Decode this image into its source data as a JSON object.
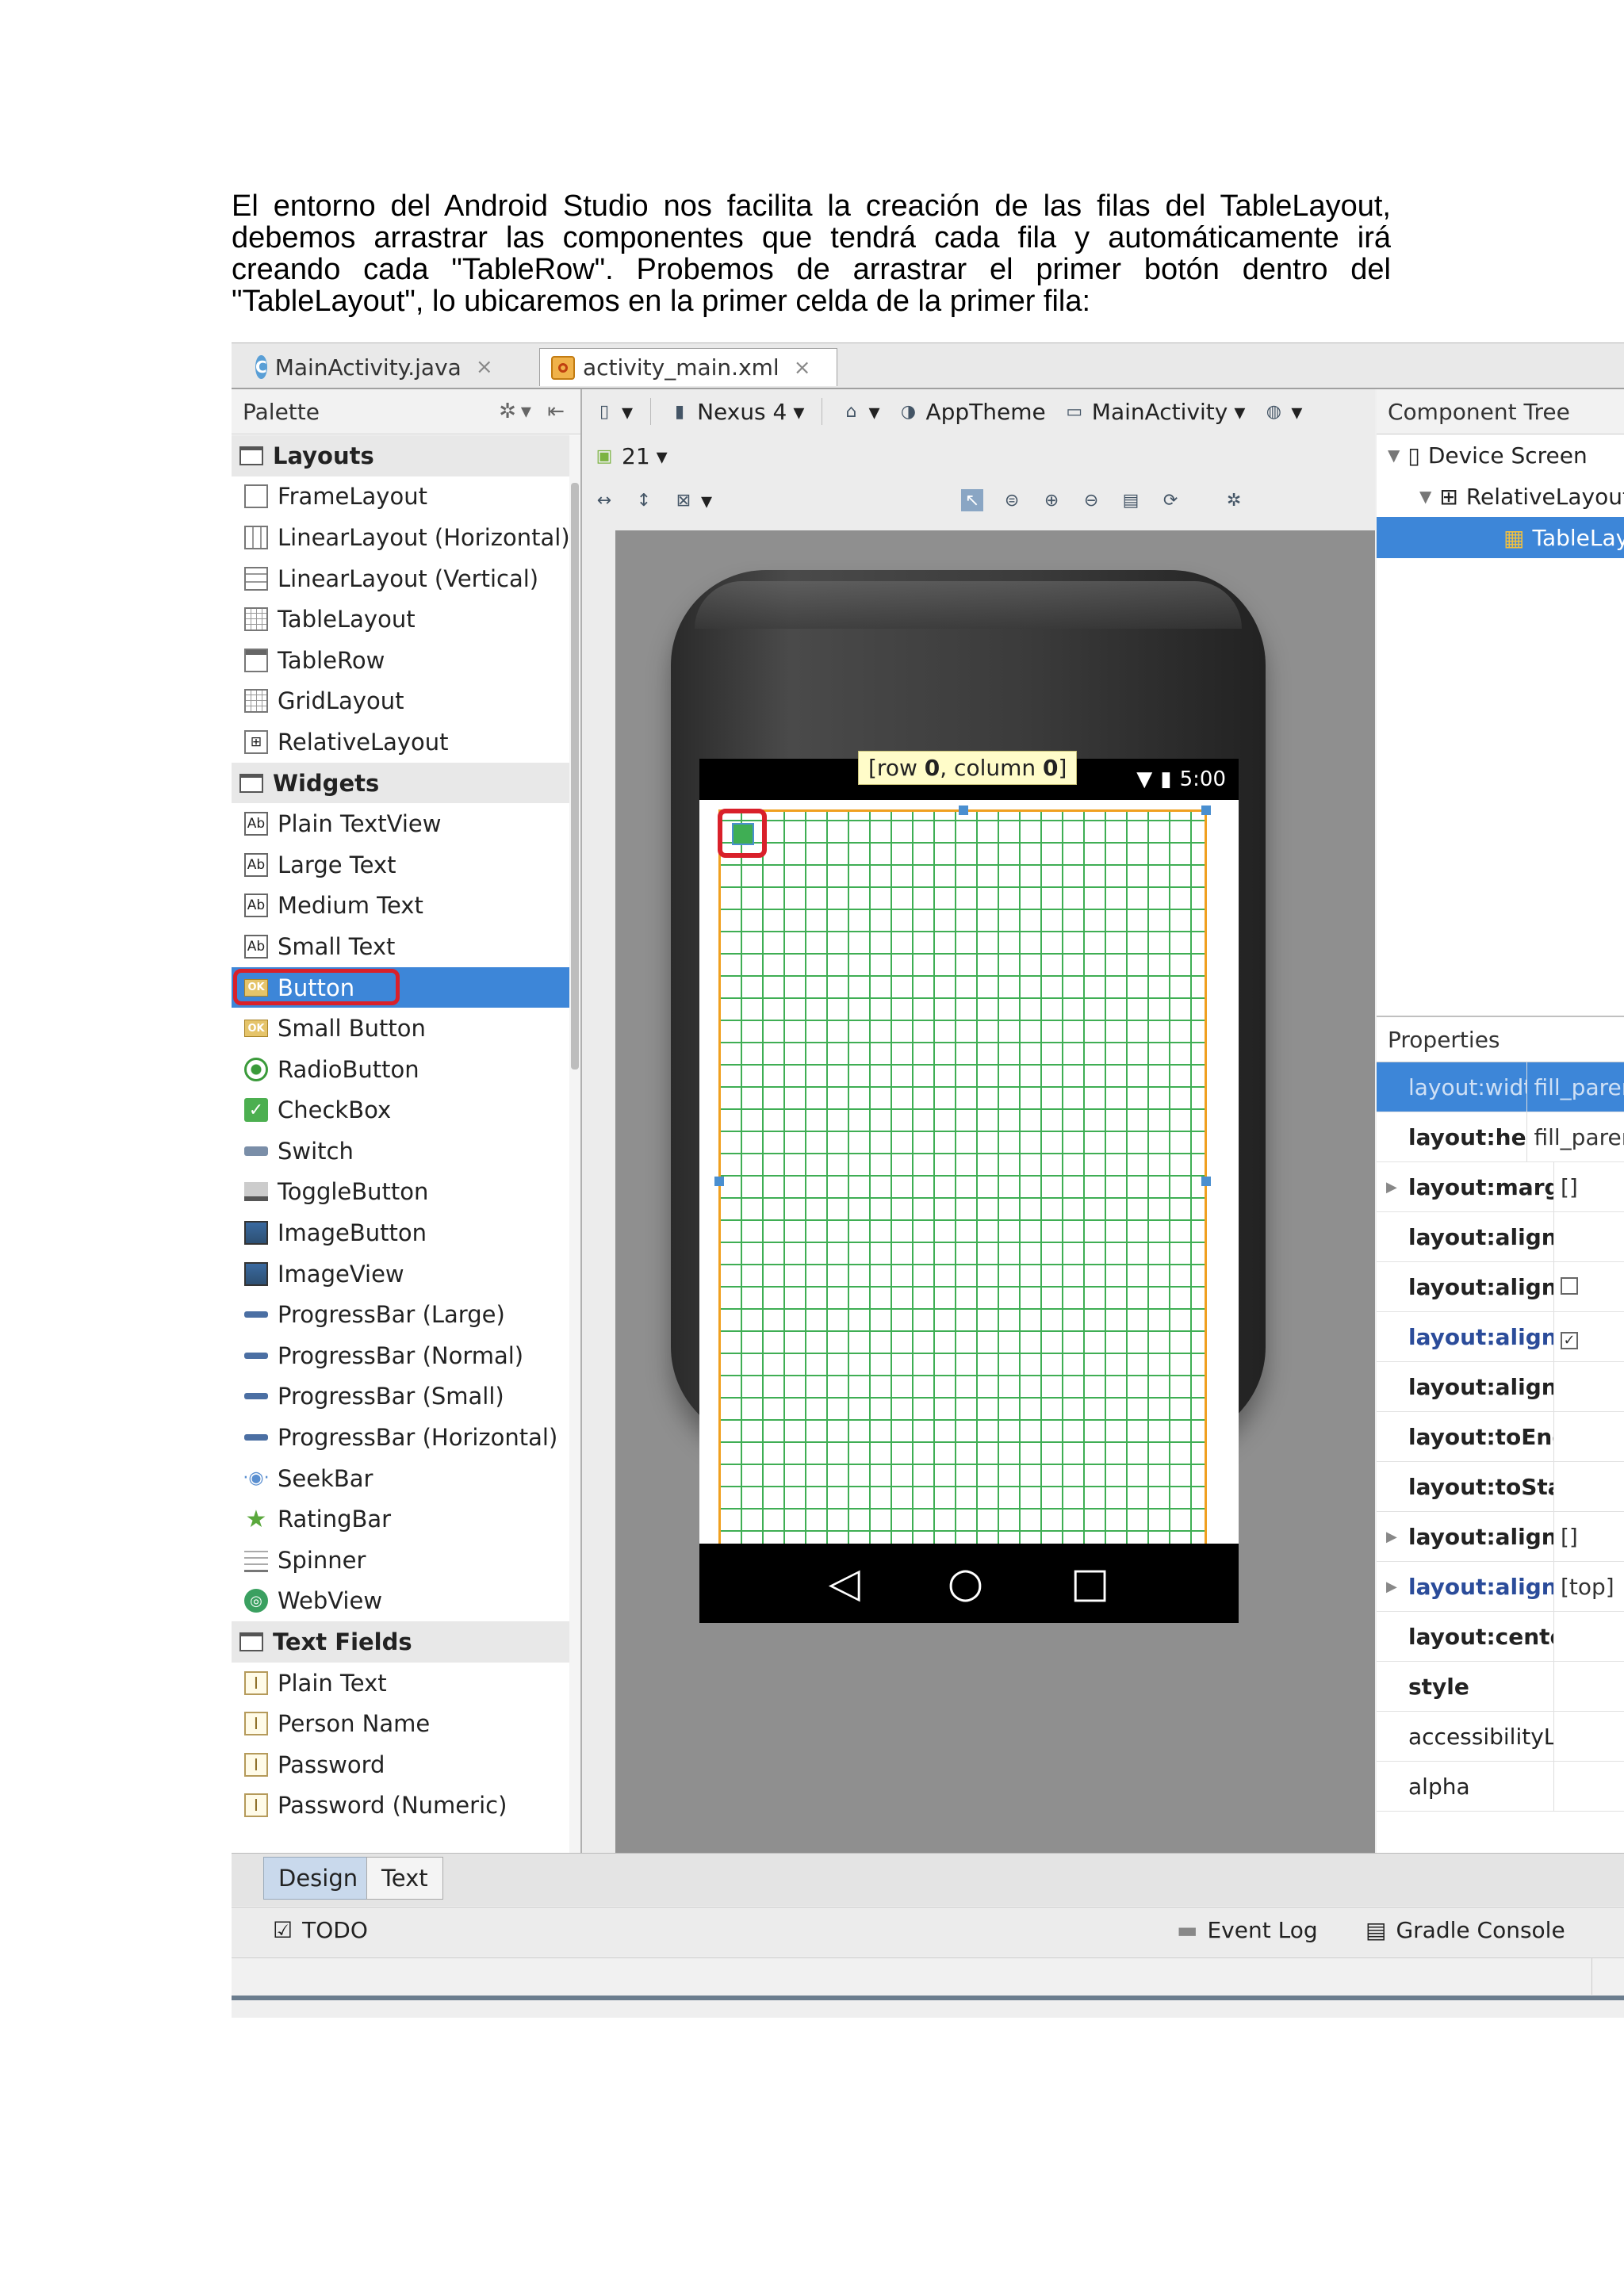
{
  "intro_text": "El entorno del Android Studio nos facilita la creación de las filas del TableLayout, debemos arrastrar las componentes que tendrá cada fila y automáticamente irá creando cada \"TableRow\". Probemos de arrastrar el primer botón dentro del \"TableLayout\", lo ubicaremos en la primer celda de la primer fila:",
  "editor_tabs": [
    {
      "label": "MainActivity.java"
    },
    {
      "label": "activity_main.xml"
    }
  ],
  "palette": {
    "title": "Palette",
    "items": [
      {
        "label": "Layouts",
        "icon": "folder-icon",
        "category": true
      },
      {
        "label": "FrameLayout",
        "icon": "frame-layout-icon"
      },
      {
        "label": "LinearLayout (Horizontal)",
        "icon": "linear-layout-horizontal-icon"
      },
      {
        "label": "LinearLayout (Vertical)",
        "icon": "linear-layout-vertical-icon"
      },
      {
        "label": "TableLayout",
        "icon": "table-layout-icon"
      },
      {
        "label": "TableRow",
        "icon": "table-row-icon"
      },
      {
        "label": "GridLayout",
        "icon": "grid-layout-icon"
      },
      {
        "label": "RelativeLayout",
        "icon": "relative-layout-icon"
      },
      {
        "label": "Widgets",
        "icon": "folder-icon",
        "category": true
      },
      {
        "label": "Plain TextView",
        "icon": "textview-icon"
      },
      {
        "label": "Large Text",
        "icon": "textview-icon"
      },
      {
        "label": "Medium Text",
        "icon": "textview-icon"
      },
      {
        "label": "Small Text",
        "icon": "textview-icon"
      },
      {
        "label": "Button",
        "icon": "button-icon",
        "selected": true
      },
      {
        "label": "Small Button",
        "icon": "button-icon"
      },
      {
        "label": "RadioButton",
        "icon": "radio-icon"
      },
      {
        "label": "CheckBox",
        "icon": "checkbox-icon"
      },
      {
        "label": "Switch",
        "icon": "switch-icon"
      },
      {
        "label": "ToggleButton",
        "icon": "toggle-icon"
      },
      {
        "label": "ImageButton",
        "icon": "image-button-icon"
      },
      {
        "label": "ImageView",
        "icon": "image-view-icon"
      },
      {
        "label": "ProgressBar (Large)",
        "icon": "progressbar-icon"
      },
      {
        "label": "ProgressBar (Normal)",
        "icon": "progressbar-icon"
      },
      {
        "label": "ProgressBar (Small)",
        "icon": "progressbar-icon"
      },
      {
        "label": "ProgressBar (Horizontal)",
        "icon": "progressbar-icon"
      },
      {
        "label": "SeekBar",
        "icon": "seekbar-icon"
      },
      {
        "label": "RatingBar",
        "icon": "star-icon"
      },
      {
        "label": "Spinner",
        "icon": "spinner-icon"
      },
      {
        "label": "WebView",
        "icon": "globe-icon"
      },
      {
        "label": "Text Fields",
        "icon": "folder-icon",
        "category": true
      },
      {
        "label": "Plain Text",
        "icon": "text-field-icon"
      },
      {
        "label": "Person Name",
        "icon": "text-field-icon"
      },
      {
        "label": "Password",
        "icon": "text-field-icon"
      },
      {
        "label": "Password (Numeric)",
        "icon": "text-field-icon"
      }
    ]
  },
  "toolbar": {
    "device": "Nexus 4",
    "theme": "AppTheme",
    "activity": "MainActivity",
    "api_level": "21"
  },
  "device_preview": {
    "tooltip_prefix": "[row ",
    "tooltip_row": "0",
    "tooltip_mid": ", column ",
    "tooltip_col": "0",
    "tooltip_suffix": "]",
    "time": "5:00"
  },
  "component_tree": {
    "title": "Component Tree",
    "nodes": [
      {
        "label": "Device Screen",
        "icon": "device-icon"
      },
      {
        "label": "RelativeLayout",
        "icon": "relative-layout-icon"
      },
      {
        "label": "TableLayout",
        "icon": "table-layout-icon",
        "selected": true
      }
    ]
  },
  "properties": {
    "title": "Properties",
    "rows": [
      {
        "key": "layout:width",
        "value": "fill_parent",
        "selected": true
      },
      {
        "key": "layout:height",
        "value": "fill_parent",
        "bold": true
      },
      {
        "key": "layout:margin",
        "value": "[]",
        "bold": true,
        "expandable": true
      },
      {
        "key": "layout:alignEnd",
        "value": "",
        "bold": true
      },
      {
        "key": "layout:alignParentLeft",
        "value": "",
        "bold": true,
        "checkbox": "unchecked"
      },
      {
        "key": "layout:alignParentStart",
        "value": "",
        "bold": true,
        "blue": true,
        "checkbox": "checked"
      },
      {
        "key": "layout:alignStart",
        "value": "",
        "bold": true
      },
      {
        "key": "layout:toEndOf",
        "value": "",
        "bold": true
      },
      {
        "key": "layout:toStartOf",
        "value": "",
        "bold": true
      },
      {
        "key": "layout:alignComponent",
        "value": "[]",
        "bold": true,
        "expandable": true
      },
      {
        "key": "layout:alignParent",
        "value": "[top]",
        "bold": true,
        "blue": true,
        "expandable": true
      },
      {
        "key": "layout:centerInParent",
        "value": "",
        "bold": true
      },
      {
        "key": "style",
        "value": "",
        "bold": true
      },
      {
        "key": "accessibilityLiveRegion",
        "value": ""
      },
      {
        "key": "alpha",
        "value": ""
      }
    ]
  },
  "bottom_tabs": [
    {
      "label": "Design",
      "active": true
    },
    {
      "label": "Text",
      "active": false
    }
  ],
  "tool_windows": {
    "todo": "TODO",
    "event_log": "Event Log",
    "gradle_console": "Gradle Console"
  },
  "colors": {
    "selection_blue": "#3d86d8",
    "highlight_red": "#d9202a",
    "grid_green": "#3fae54",
    "table_border_orange": "#f0a020"
  }
}
